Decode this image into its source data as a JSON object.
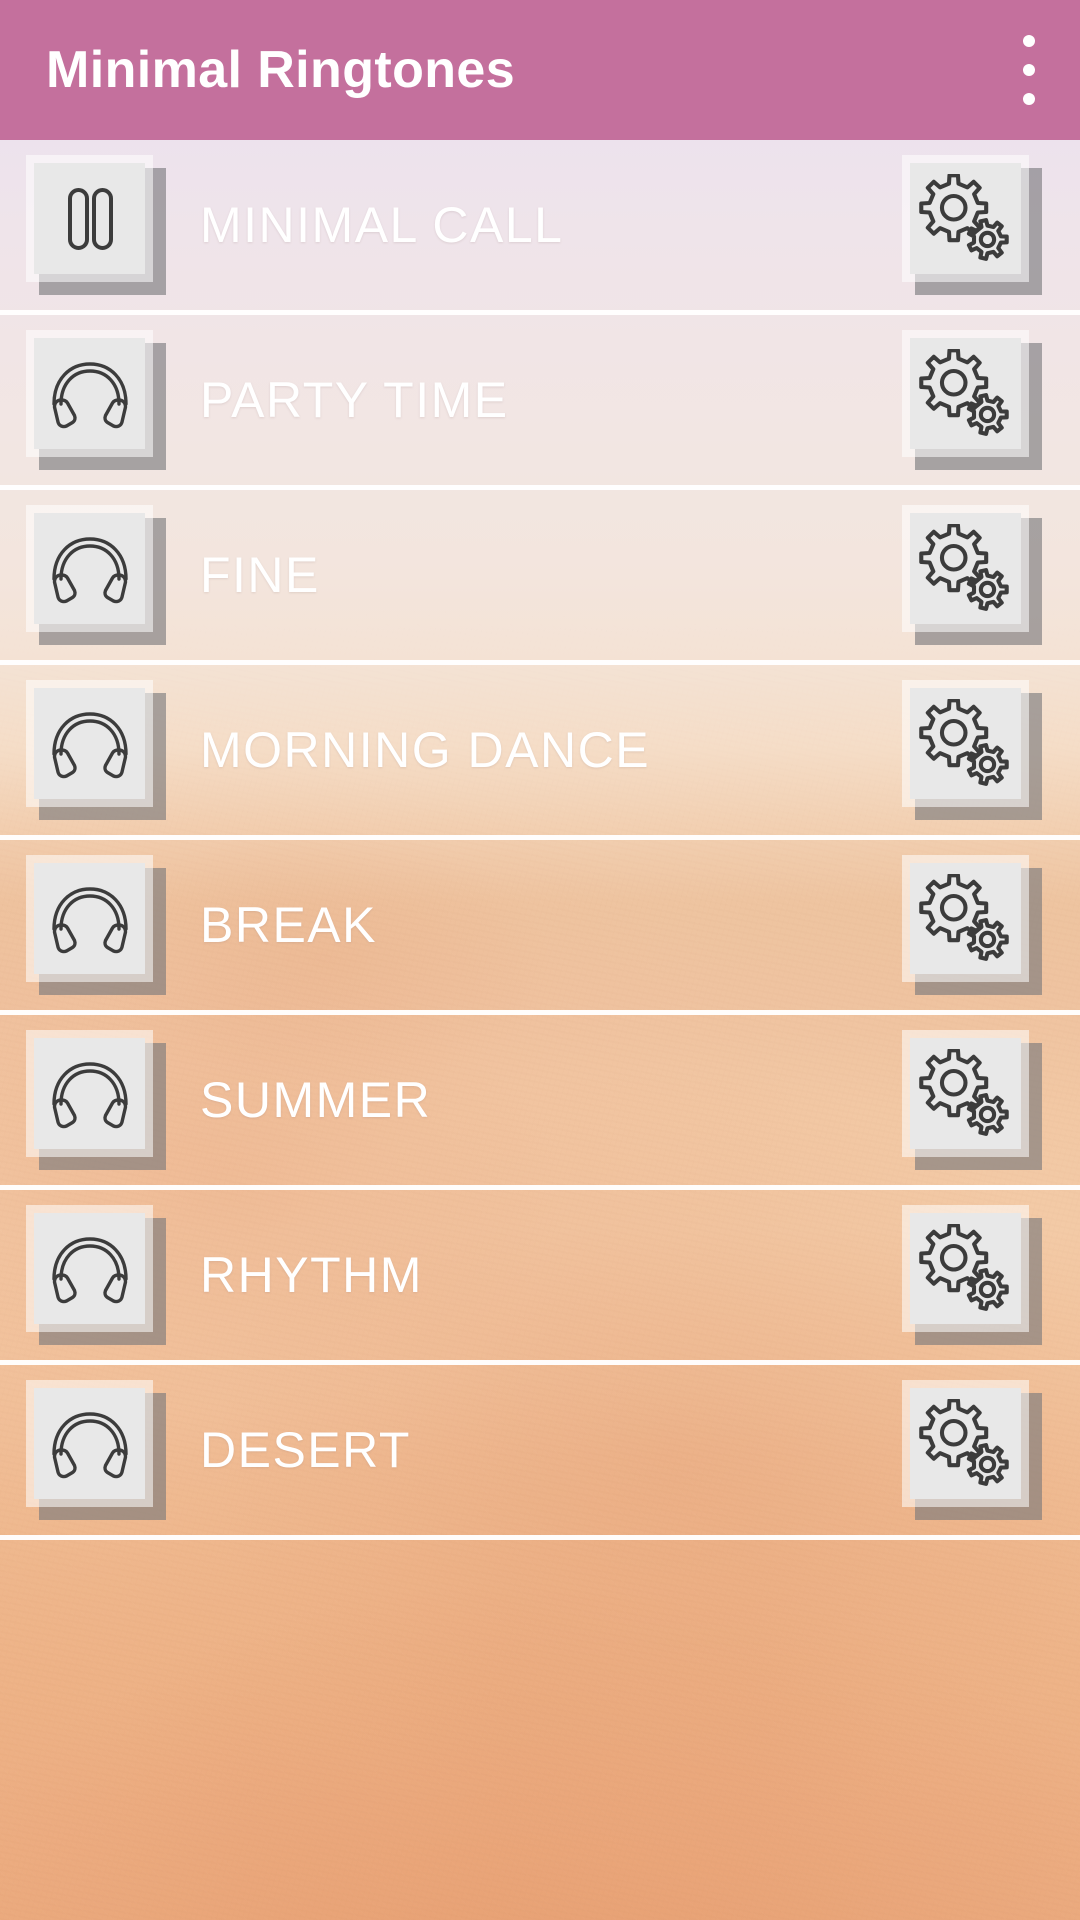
{
  "app": {
    "title": "Minimal Ringtones",
    "header_color": "#c4709d",
    "title_color": "#ffffff"
  },
  "header": {
    "overflow_menu": "overflow-menu"
  },
  "list": {
    "items": [
      {
        "label": "MINIMAL CALL",
        "left_icon": "pause-icon",
        "right_icon": "gears-icon"
      },
      {
        "label": "PARTY TIME",
        "left_icon": "headphones-icon",
        "right_icon": "gears-icon"
      },
      {
        "label": "FINE",
        "left_icon": "headphones-icon",
        "right_icon": "gears-icon"
      },
      {
        "label": "MORNING DANCE",
        "left_icon": "headphones-icon",
        "right_icon": "gears-icon"
      },
      {
        "label": "BREAK",
        "left_icon": "headphones-icon",
        "right_icon": "gears-icon"
      },
      {
        "label": "SUMMER",
        "left_icon": "headphones-icon",
        "right_icon": "gears-icon"
      },
      {
        "label": "RHYTHM",
        "left_icon": "headphones-icon",
        "right_icon": "gears-icon"
      },
      {
        "label": "DESERT",
        "left_icon": "headphones-icon",
        "right_icon": "gears-icon"
      }
    ]
  },
  "colors": {
    "accent": "#c4709d",
    "icon_tile": "#e8e8e8",
    "icon_stroke": "#3c3c3c",
    "label": "#ffffff",
    "divider": "#ffffff"
  }
}
